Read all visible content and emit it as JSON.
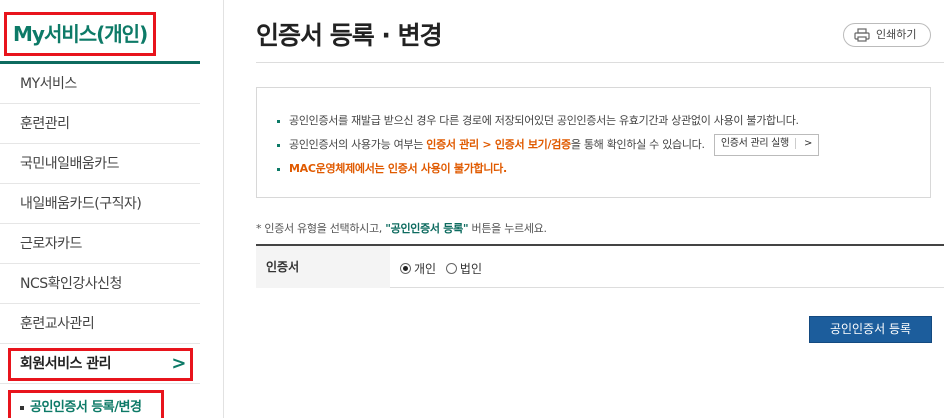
{
  "sidebar": {
    "title": "My서비스(개인)",
    "items": [
      {
        "label": "MY서비스"
      },
      {
        "label": "훈련관리"
      },
      {
        "label": "국민내일배움카드"
      },
      {
        "label": "내일배움카드(구직자)"
      },
      {
        "label": "근로자카드"
      },
      {
        "label": "NCS확인강사신청"
      },
      {
        "label": "훈련교사관리"
      },
      {
        "label": "회원서비스 관리"
      }
    ],
    "active_chevron": ">",
    "sub_item": "공인인증서 등록/변경"
  },
  "header": {
    "title": "인증서 등록 · 변경",
    "print_label": "인쇄하기"
  },
  "notice": {
    "line1": "공인인증서를 재발급 받으신 경우 다른 경로에 저장되어있던 공인인증서는 유효기간과 상관없이 사용이 불가합니다.",
    "line2_prefix": "공인인증서의 사용가능 여부는 ",
    "line2_highlight": "인증서 관리 > 인증서 보기/검증",
    "line2_suffix": "을 통해 확인하실 수 있습니다.",
    "run_button": "인증서 관리 실행",
    "run_arrow": ">",
    "line3": "MAC운영체제에서는 인증서 사용이 불가합니다."
  },
  "guide": {
    "prefix": "* 인증서 유형을 선택하시고, ",
    "emphasis": "\"공인인증서 등록\"",
    "suffix": " 버튼을 누르세요."
  },
  "form": {
    "label": "인증서",
    "options": [
      {
        "label": "개인",
        "selected": true
      },
      {
        "label": "법인",
        "selected": false
      }
    ]
  },
  "submit_label": "공인인증서 등록",
  "colors": {
    "accent": "#0d7a67",
    "highlight": "#e05a00",
    "button": "#1c5d9c",
    "annotation": "#e8141c"
  }
}
